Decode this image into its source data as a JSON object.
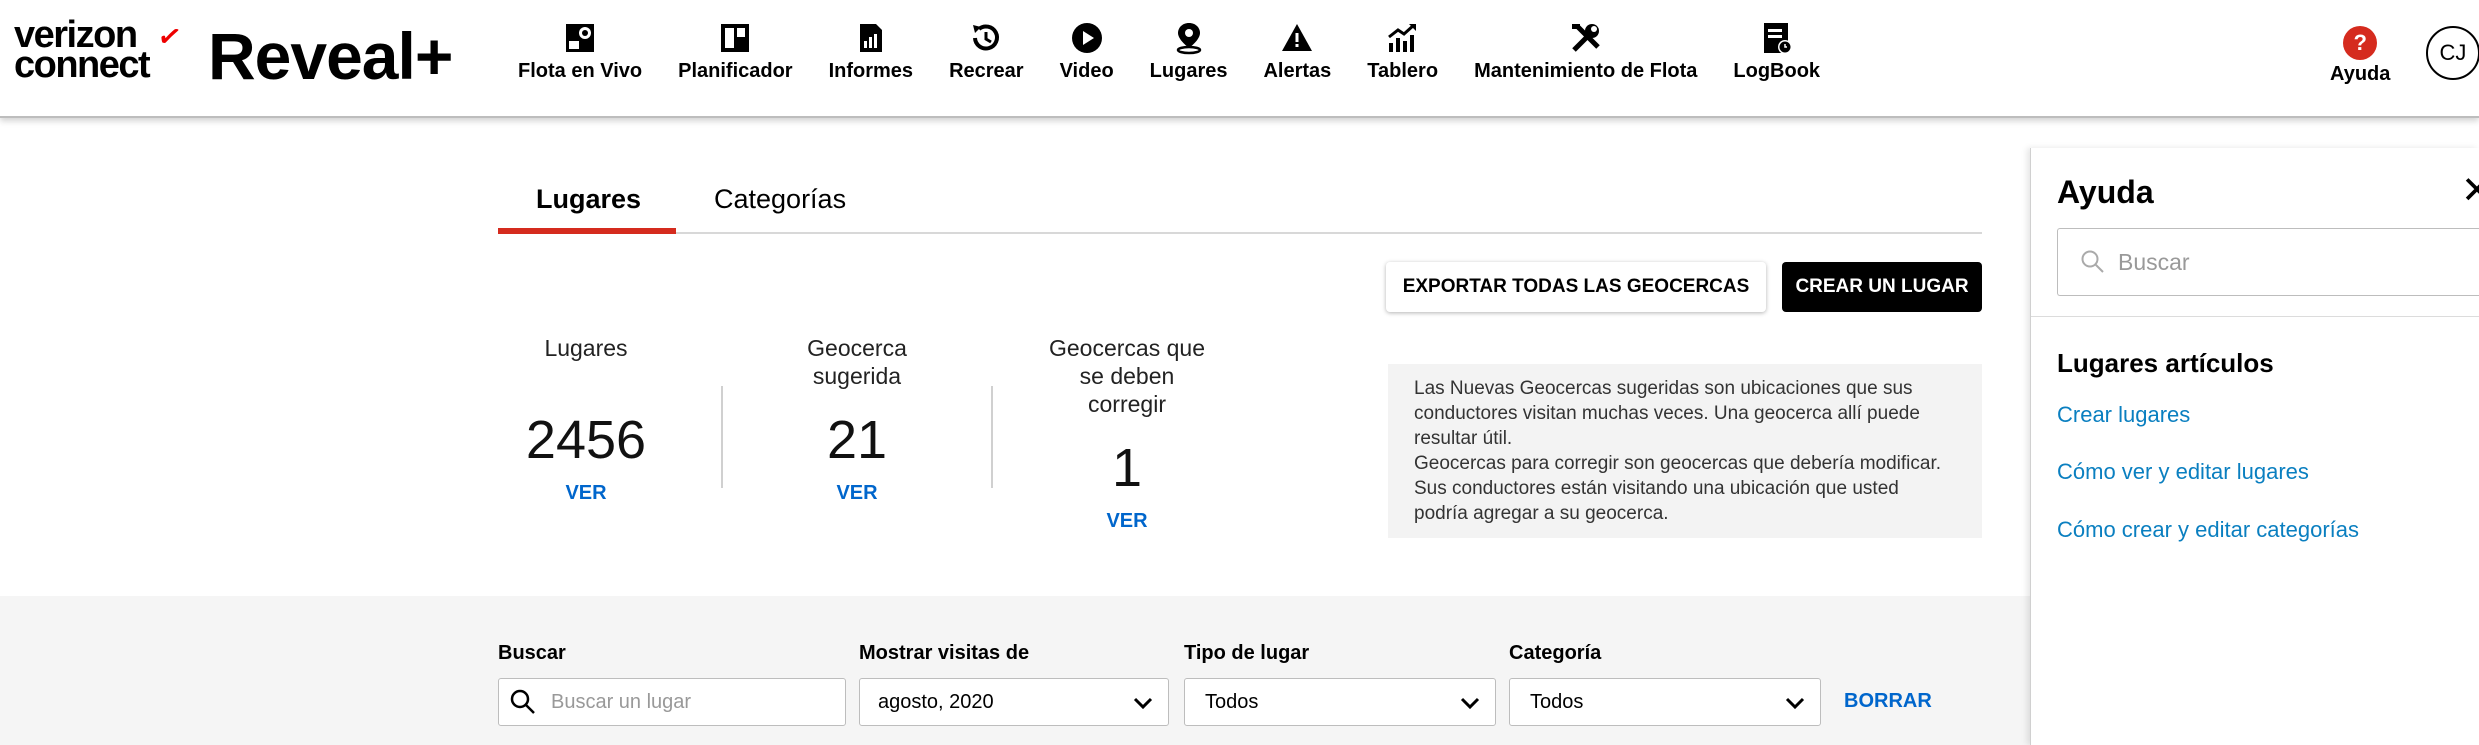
{
  "brand": {
    "company_line1": "verizon",
    "company_line2": "connect",
    "check_mark": "✓",
    "product": "Reveal+",
    "accent_red": "#d52b1e",
    "link_blue": "#0066cc"
  },
  "nav": {
    "items": [
      {
        "label": "Flota en Vivo",
        "icon": "fleet-map-icon"
      },
      {
        "label": "Planificador",
        "icon": "planner-icon"
      },
      {
        "label": "Informes",
        "icon": "report-icon"
      },
      {
        "label": "Recrear",
        "icon": "replay-icon"
      },
      {
        "label": "Video",
        "icon": "video-play-icon"
      },
      {
        "label": "Lugares",
        "icon": "location-pin-icon"
      },
      {
        "label": "Alertas",
        "icon": "alert-icon"
      },
      {
        "label": "Tablero",
        "icon": "dashboard-chart-icon"
      },
      {
        "label": "Mantenimiento de Flota",
        "icon": "maintenance-tools-icon"
      },
      {
        "label": "LogBook",
        "icon": "logbook-icon"
      }
    ],
    "help_badge": "?",
    "help_label": "Ayuda",
    "user_initials": "CJ"
  },
  "tabs": {
    "places": "Lugares",
    "categories": "Categorías"
  },
  "actions": {
    "export_label": "EXPORTAR TODAS LAS GEOCERCAS",
    "create_label": "CREAR UN LUGAR"
  },
  "stats": {
    "places": {
      "title": "Lugares",
      "value": "2456",
      "link": "VER"
    },
    "suggested": {
      "title_line1": "Geocerca",
      "title_line2": "sugerida",
      "value": "21",
      "link": "VER"
    },
    "to_fix": {
      "title_line1": "Geocercas que",
      "title_line2": "se deben",
      "title_line3": "corregir",
      "value": "1",
      "link": "VER"
    }
  },
  "info": {
    "paragraph1": "Las Nuevas Geocercas sugeridas son ubicaciones que sus conductores visitan muchas veces. Una geocerca allí puede resultar útil.",
    "paragraph2": "Geocercas para corregir son geocercas que debería modificar. Sus conductores están visitando una ubicación que usted podría agregar a su geocerca."
  },
  "filters": {
    "search_label": "Buscar",
    "search_placeholder": "Buscar un lugar",
    "visits_label": "Mostrar visitas de",
    "visits_value": "agosto, 2020",
    "type_label": "Tipo de lugar",
    "type_value": "Todos",
    "category_label": "Categoría",
    "category_value": "Todos",
    "clear_label": "BORRAR"
  },
  "help_panel": {
    "title": "Ayuda",
    "close": "✕",
    "search_placeholder": "Buscar",
    "section_title": "Lugares artículos",
    "links": [
      "Crear lugares",
      "Cómo ver y editar lugares",
      "Cómo crear y editar categorías"
    ]
  }
}
